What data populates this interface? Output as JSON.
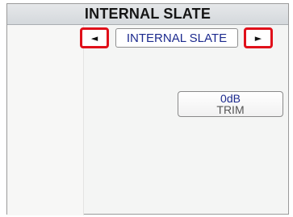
{
  "header": {
    "title": "INTERNAL SLATE"
  },
  "nav": {
    "prev_glyph": "◄",
    "selected_label": "INTERNAL SLATE",
    "next_glyph": "►"
  },
  "trim": {
    "value": "0dB",
    "label": "TRIM"
  },
  "colors": {
    "highlight": "#e0101a",
    "value_text": "#1c2a8e"
  }
}
